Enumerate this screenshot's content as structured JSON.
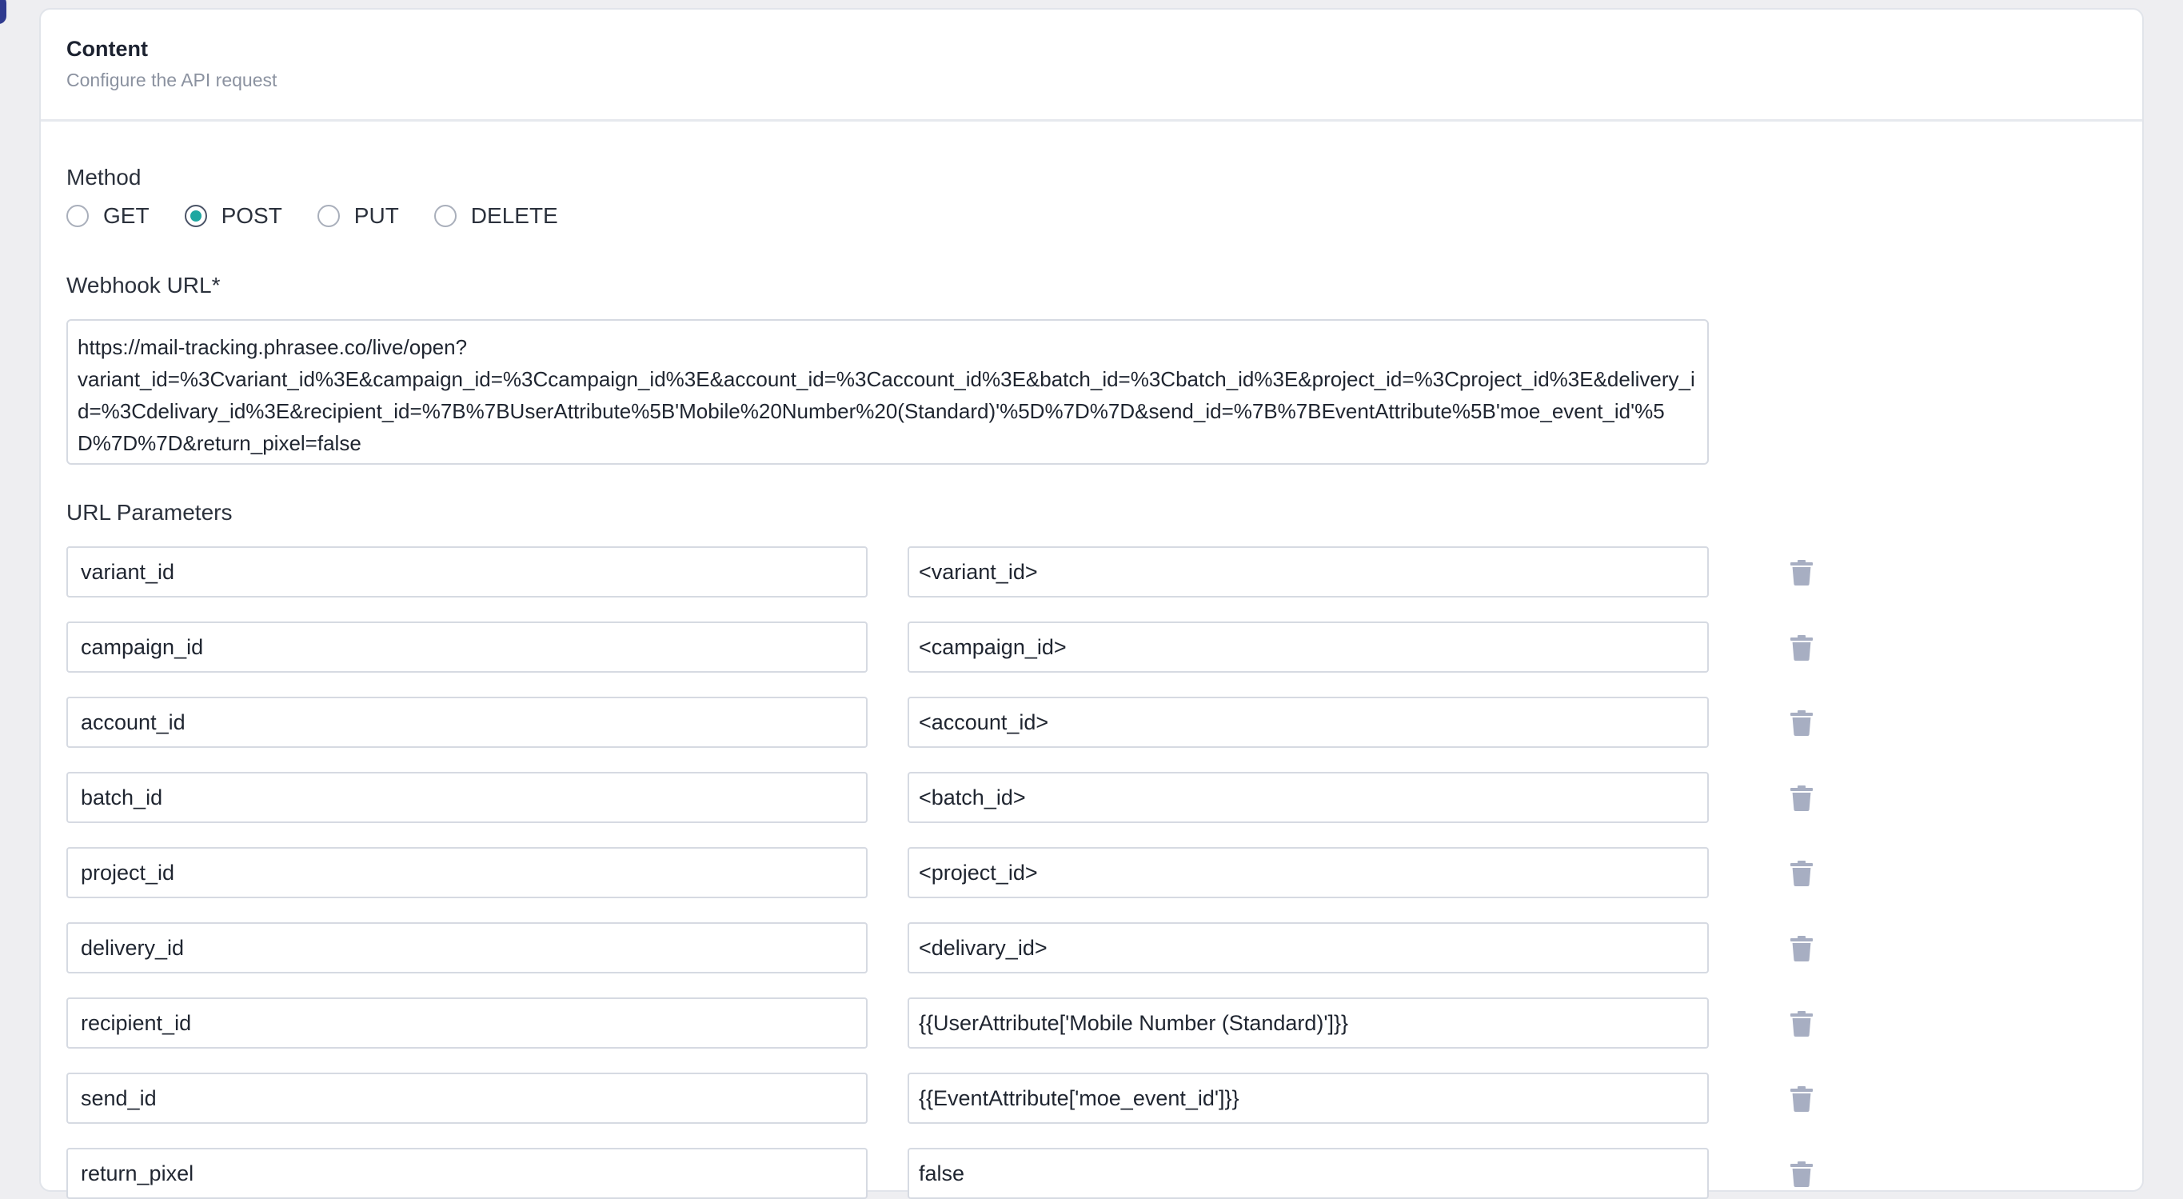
{
  "card": {
    "title": "Content",
    "subtitle": "Configure the API request"
  },
  "method": {
    "label": "Method",
    "options": [
      "GET",
      "POST",
      "PUT",
      "DELETE"
    ],
    "selected": "POST"
  },
  "webhook": {
    "label": "Webhook URL*",
    "value": "https://mail-tracking.phrasee.co/live/open?\nvariant_id=%3Cvariant_id%3E&campaign_id=%3Ccampaign_id%3E&account_id=%3Caccount_id%3E&batch_id=%3Cbatch_id%3E&project_id=%3Cproject_id%3E&delivery_id=%3Cdelivary_id%3E&recipient_id=%7B%7BUserAttribute%5B'Mobile%20Number%20(Standard)'%5D%7D%7D&send_id=%7B%7BEventAttribute%5B'moe_event_id'%5D%7D%7D&return_pixel=false"
  },
  "params": {
    "label": "URL Parameters",
    "rows": [
      {
        "key": "variant_id",
        "value": "<variant_id>"
      },
      {
        "key": "campaign_id",
        "value": "<campaign_id>"
      },
      {
        "key": "account_id",
        "value": "<account_id>"
      },
      {
        "key": "batch_id",
        "value": "<batch_id>"
      },
      {
        "key": "project_id",
        "value": "<project_id>"
      },
      {
        "key": "delivery_id",
        "value": "<delivary_id>"
      },
      {
        "key": "recipient_id",
        "value": "{{UserAttribute['Mobile Number (Standard)']}}"
      },
      {
        "key": "send_id",
        "value": "{{EventAttribute['moe_event_id']}}"
      },
      {
        "key": "return_pixel",
        "value": "false"
      }
    ]
  },
  "colors": {
    "accent": "#1ea7a1",
    "trash": "#a7aec2"
  },
  "icons": {
    "delete": "trash-icon"
  }
}
